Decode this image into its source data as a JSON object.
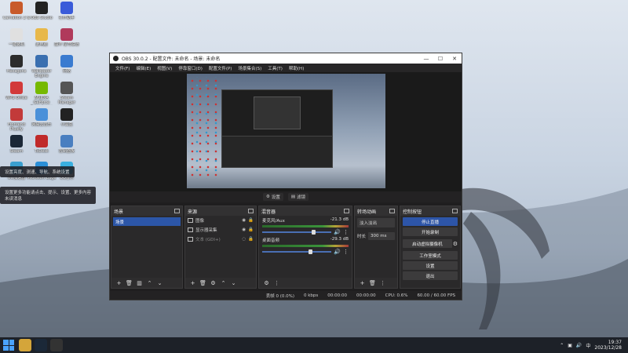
{
  "desktop": {
    "icons": [
      {
        "label": "Carnation 2 &",
        "color": "#c85a2a"
      },
      {
        "label": "OBS Studio",
        "color": "#222222"
      },
      {
        "label": "打开助手",
        "color": "#3a5bd9"
      },
      {
        "label": "一键装机",
        "color": "#e0e0e0"
      },
      {
        "label": "此电脑",
        "color": "#e8b84a"
      },
      {
        "label": "崩坏 星穹铁道",
        "color": "#b03a5b"
      },
      {
        "label": "Hexagons",
        "color": "#2c2c2c"
      },
      {
        "label": "Wallpaper Engine",
        "color": "#3a6fb0"
      },
      {
        "label": "网络",
        "color": "#3a7bd0"
      },
      {
        "label": "WPS Office",
        "color": "#d23a3a"
      },
      {
        "label": "NVIDIA GeForce Experience",
        "color": "#76b900"
      },
      {
        "label": "Steam Manager",
        "color": "#555555"
      },
      {
        "label": "Frontend Plusify",
        "color": "#c23a3a"
      },
      {
        "label": "网易云音乐",
        "color": "#4a90d9"
      },
      {
        "label": "小黑盒",
        "color": "#222222"
      },
      {
        "label": "Steam",
        "color": "#1b2838"
      },
      {
        "label": "ToDesk",
        "color": "#c02a2a"
      },
      {
        "label": "控制面板",
        "color": "#4a7fc0"
      },
      {
        "label": "UU加速器",
        "color": "#3aa0d0"
      },
      {
        "label": "Microsoft Edge",
        "color": "#2a8fd8"
      },
      {
        "label": "QQ音乐",
        "color": "#3ab0e0"
      }
    ],
    "notifications": [
      "设置亮度、测速、导航、系统设置",
      "设置更多功能请点击、提示、设置、更多内容",
      "未读消息"
    ]
  },
  "obs": {
    "title": "OBS 30.0.2 - 配置文件: 未命名 - 场景: 未命名",
    "menu": [
      "文件(F)",
      "编辑(E)",
      "视图(V)",
      "停靠窗口(D)",
      "配置文件(P)",
      "场景集合(S)",
      "工具(T)",
      "帮助(H)"
    ],
    "scene_toolbar": {
      "settings": "设置",
      "filters": "滤镜"
    },
    "docks": {
      "scenes": {
        "title": "场景",
        "items": [
          "场景"
        ]
      },
      "sources": {
        "title": "来源",
        "items": [
          {
            "name": "图像",
            "dim": false
          },
          {
            "name": "显示器采集",
            "dim": false
          },
          {
            "name": "文本 (GDI+)",
            "dim": true
          }
        ]
      },
      "mixer": {
        "title": "混音器",
        "channels": [
          {
            "name": "麦克风/Aux",
            "db": "-21.3 dB",
            "level": 0.75
          },
          {
            "name": "桌面音频",
            "db": "-29.3 dB",
            "level": 0.7
          }
        ]
      },
      "transitions": {
        "title": "转场动画",
        "type": "淡入淡出",
        "duration_label": "时长",
        "duration": "300 ms"
      },
      "controls": {
        "title": "控制按钮",
        "buttons": [
          "停止直播",
          "开始录制",
          "启动虚拟摄像机",
          "工作室模式",
          "设置",
          "退出"
        ]
      }
    },
    "status": {
      "dropped": "丢帧 0 (0.0%)",
      "bitrate": "0 kbps",
      "stream_time": "00:00:00",
      "rec_time": "00:00:00",
      "cpu": "CPU: 0.6%",
      "fps": "60.00 / 60.00 FPS"
    }
  },
  "taskbar": {
    "time": "19:37",
    "date": "2023/12/28",
    "lang": "中"
  }
}
